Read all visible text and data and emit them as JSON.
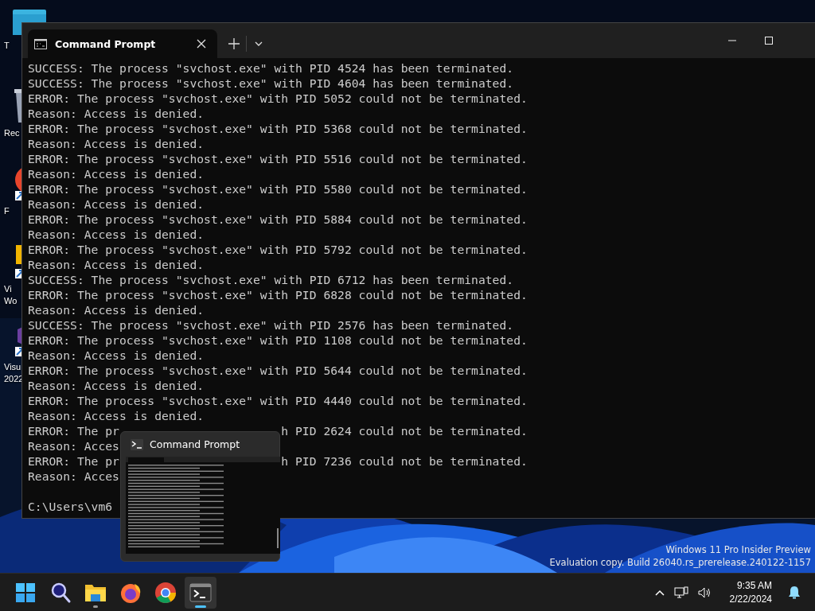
{
  "desktop": {
    "icons": [
      {
        "kind": "folder",
        "lines": [
          "T"
        ]
      },
      {
        "kind": "recycle",
        "lines": [
          "Rec"
        ]
      },
      {
        "kind": "firefox",
        "lines": [
          "F"
        ]
      },
      {
        "kind": "vmware",
        "lines": [
          "Vi",
          "Wo"
        ]
      },
      {
        "kind": "studio",
        "lines": [
          "Visu",
          "2022"
        ]
      }
    ],
    "os_notice": [
      "Windows 11 Pro Insider Preview",
      "Evaluation copy. Build 26040.rs_prerelease.240122-1157"
    ]
  },
  "window": {
    "tab": {
      "title": "Command Prompt",
      "selected": true
    },
    "lines": [
      {
        "text": "SUCCESS: The process \"svchost.exe\" with PID 4524 has been terminated."
      },
      {
        "text": "SUCCESS: The process \"svchost.exe\" with PID 4604 has been terminated."
      },
      {
        "text": "ERROR: The process \"svchost.exe\" with PID 5052 could not be terminated."
      },
      {
        "text": "Reason: Access is denied."
      },
      {
        "text": "ERROR: The process \"svchost.exe\" with PID 5368 could not be terminated."
      },
      {
        "text": "Reason: Access is denied."
      },
      {
        "text": "ERROR: The process \"svchost.exe\" with PID 5516 could not be terminated."
      },
      {
        "text": "Reason: Access is denied."
      },
      {
        "text": "ERROR: The process \"svchost.exe\" with PID 5580 could not be terminated."
      },
      {
        "text": "Reason: Access is denied."
      },
      {
        "text": "ERROR: The process \"svchost.exe\" with PID 5884 could not be terminated."
      },
      {
        "text": "Reason: Access is denied."
      },
      {
        "text": "ERROR: The process \"svchost.exe\" with PID 5792 could not be terminated."
      },
      {
        "text": "Reason: Access is denied."
      },
      {
        "text": "SUCCESS: The process \"svchost.exe\" with PID 6712 has been terminated."
      },
      {
        "text": "ERROR: The process \"svchost.exe\" with PID 6828 could not be terminated."
      },
      {
        "text": "Reason: Access is denied."
      },
      {
        "text": "SUCCESS: The process \"svchost.exe\" with PID 2576 has been terminated."
      },
      {
        "text": "ERROR: The process \"svchost.exe\" with PID 1108 could not be terminated."
      },
      {
        "text": "Reason: Access is denied."
      },
      {
        "text": "ERROR: The process \"svchost.exe\" with PID 5644 could not be terminated."
      },
      {
        "text": "Reason: Access is denied."
      },
      {
        "text": "ERROR: The process \"svchost.exe\" with PID 4440 could not be terminated."
      },
      {
        "text": "Reason: Access is denied."
      },
      {
        "text": "ERROR: The pr",
        "tail": "h PID 2624 could not be terminated."
      },
      {
        "text": "Reason: Acces"
      },
      {
        "text": "ERROR: The pr",
        "tail": "h PID 7236 could not be terminated."
      },
      {
        "text": "Reason: Acces"
      }
    ],
    "prompt": "C:\\Users\\vm6"
  },
  "preview": {
    "title": "Command Prompt"
  },
  "taskbar": {
    "apps": [
      {
        "kind": "start",
        "running": false,
        "selected": false
      },
      {
        "kind": "search",
        "running": false,
        "selected": false
      },
      {
        "kind": "files",
        "running": true,
        "selected": false
      },
      {
        "kind": "firefox",
        "running": false,
        "selected": false
      },
      {
        "kind": "chrome",
        "running": false,
        "selected": false
      },
      {
        "kind": "terminal",
        "running": true,
        "selected": true
      }
    ],
    "time": "9:35 AM",
    "date": "2/22/2024"
  }
}
